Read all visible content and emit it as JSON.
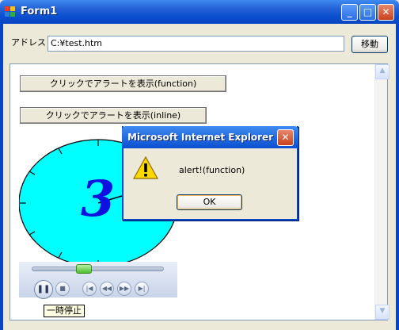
{
  "window": {
    "title": "Form1",
    "minimize_icon": "minimize-icon",
    "maximize_icon": "maximize-icon",
    "close_icon": "close-icon",
    "title_color": "#0A4FD0"
  },
  "address_bar": {
    "label": "アドレス",
    "value": "C:¥test.htm",
    "go_label": "移動"
  },
  "page": {
    "button_function": "クリックでアラートを表示(function)",
    "button_inline": "クリックでアラートを表示(inline)"
  },
  "media_player": {
    "pause_tooltip": "一時停止",
    "seek_progress": 0.38,
    "clock_digit": "3",
    "clock_face_color": "#00FFFF",
    "digit_color": "#1010E0"
  },
  "alert_dialog": {
    "title": "Microsoft Internet Explorer",
    "message": "alert!(function)",
    "ok_label": "OK",
    "icon": "warning-icon"
  }
}
